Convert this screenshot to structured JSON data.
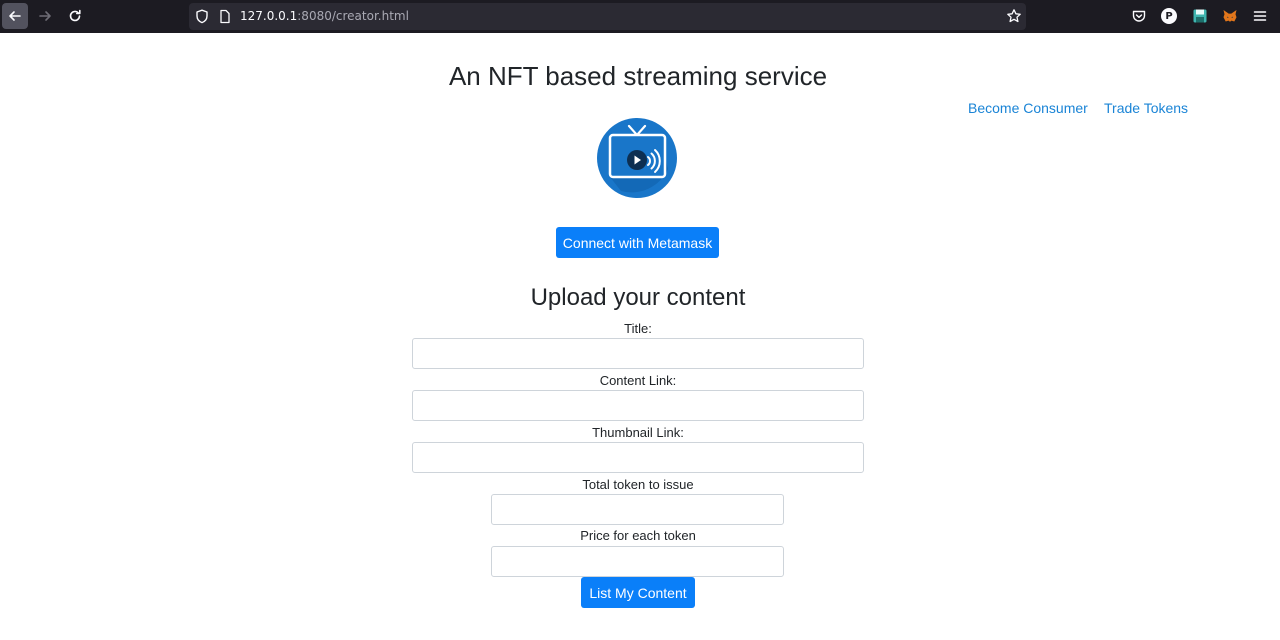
{
  "browser": {
    "url_host": "127.0.0.1",
    "url_rest": ":8080/creator.html",
    "icons": [
      "back-arrow-icon",
      "forward-arrow-icon",
      "reload-icon",
      "shield-icon",
      "page-icon",
      "bookmark-star-icon",
      "pocket-icon",
      "profile-icon",
      "save-extension-icon",
      "metamask-fox-icon",
      "menu-icon"
    ],
    "profile_letter": "P"
  },
  "header": {
    "title": "An NFT based streaming service",
    "links": [
      "Become Consumer",
      "Trade Tokens"
    ]
  },
  "logo": {
    "icon": "tv-streaming-icon",
    "color": "#1976c9"
  },
  "connect_button": "Connect with Metamask",
  "upload": {
    "title": "Upload your content",
    "fields": [
      {
        "label": "Title:",
        "value": ""
      },
      {
        "label": "Content Link:",
        "value": ""
      },
      {
        "label": "Thumbnail Link:",
        "value": ""
      },
      {
        "label": "Total token to issue",
        "value": ""
      },
      {
        "label": "Price for each token",
        "value": ""
      }
    ],
    "submit_button": "List My Content"
  },
  "colors": {
    "primary": "#0a7ff9",
    "link": "#1a84d6",
    "chrome_bg": "#1c1b22"
  }
}
